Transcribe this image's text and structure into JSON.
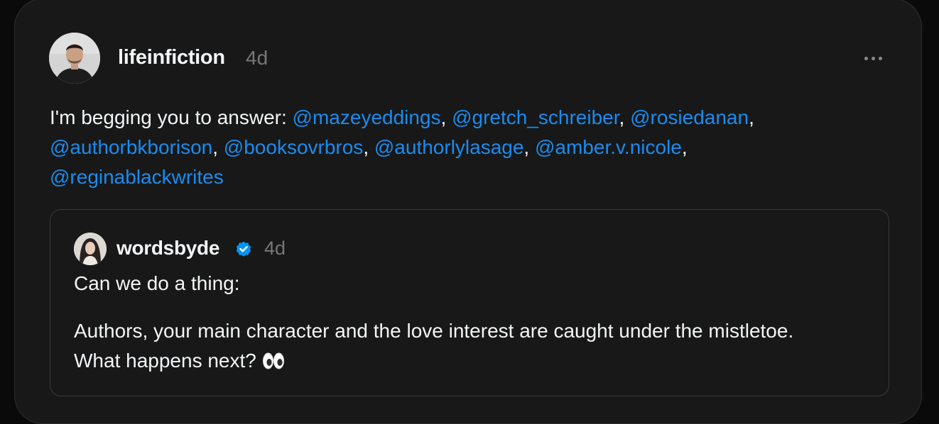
{
  "post": {
    "author": "lifeinfiction",
    "time": "4d",
    "text_prefix": "I'm begging you to answer: ",
    "mentions": [
      "@mazeyeddings",
      "@gretch_schreiber",
      "@rosiedanan",
      "@authorbkborison",
      "@booksovrbros",
      "@authorlylasage",
      "@amber.v.nicole",
      "@reginablackwrites"
    ],
    "separator": ", "
  },
  "quoted": {
    "author": "wordsbyde",
    "time": "4d",
    "line1": "Can we do a thing:",
    "paragraph": "Authors, your main character and the love interest are caught under the mistletoe. What happens next? ",
    "emoji": "eyes-emoji"
  },
  "icons": {
    "more": "more-horizontal-icon",
    "verified": "verified-badge-icon"
  },
  "colors": {
    "background": "#181818",
    "text": "#f3f5f7",
    "muted": "#777777",
    "mention": "#1a8cef",
    "verified": "#0095f6"
  }
}
